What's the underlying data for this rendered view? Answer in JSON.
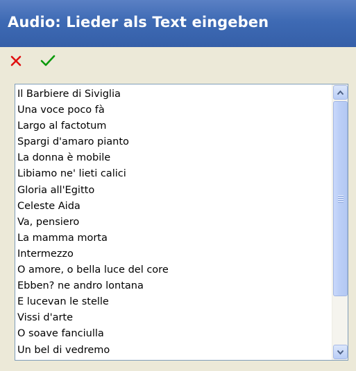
{
  "window": {
    "title": "Audio: Lieder als Text eingeben"
  },
  "toolbar": {
    "cancel_icon": "close-x-icon",
    "ok_icon": "checkmark-icon",
    "cancel_color": "#e01010",
    "ok_color": "#0b9a0b"
  },
  "songs": [
    "Il Barbiere di Siviglia",
    "Una voce poco fà",
    "Largo al factotum",
    "Spargi d'amaro pianto",
    "La donna è mobile",
    "Libiamo ne' lieti calici",
    "Gloria all'Egitto",
    "Celeste Aida",
    "Va, pensiero",
    "La mamma morta",
    "Intermezzo",
    "O amore, o bella luce del core",
    "Ebben? ne andro lontana",
    "E lucevan le stelle",
    "Vissi d'arte",
    "O soave fanciulla",
    "Un bel di vedremo"
  ],
  "scrollbar": {
    "position_fraction": 0.0,
    "up_icon": "chevron-up-icon",
    "down_icon": "chevron-down-icon"
  }
}
